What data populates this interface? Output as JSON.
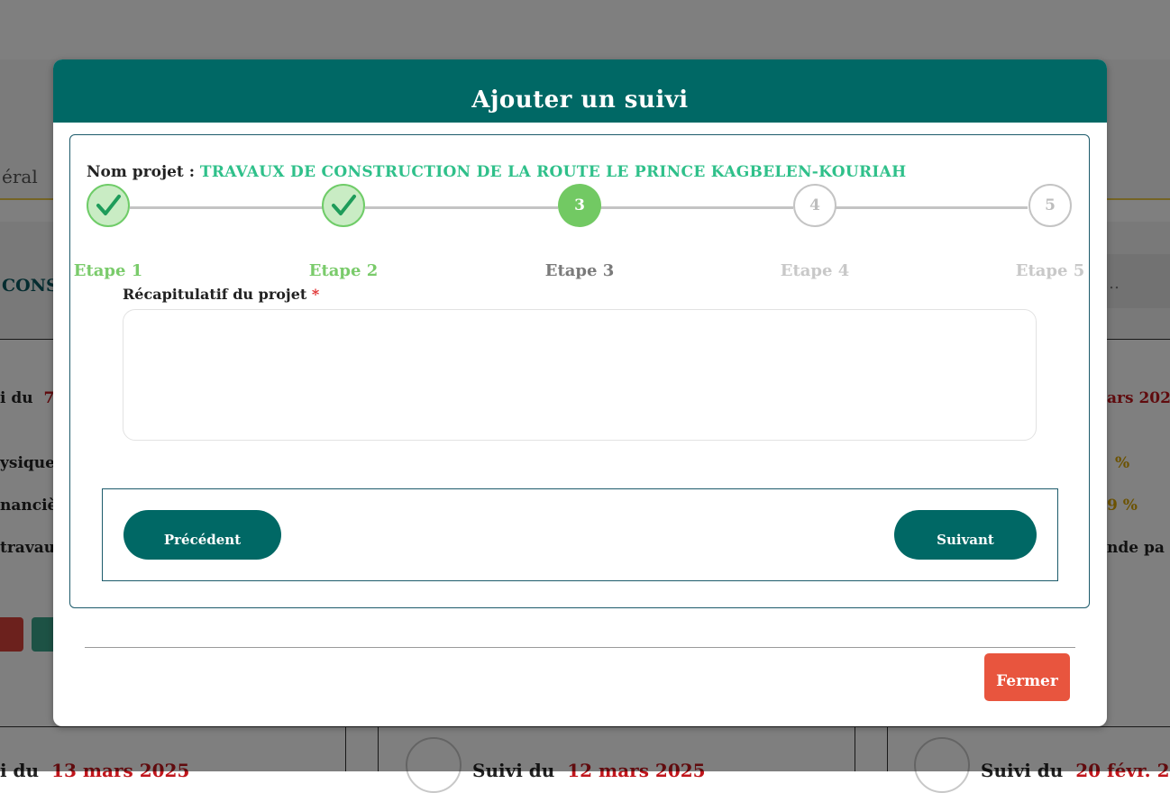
{
  "background": {
    "nav_fragment": "éral",
    "band_fragment": "CONS",
    "search_fragment": "…",
    "card_left": {
      "suivi_prefix": "i du",
      "suivi_date": "7",
      "physique": "ysique",
      "financier": "nanciè",
      "travaux": "travau"
    },
    "card_right": {
      "suivi_date": "ars 202",
      "physique_pct": "%",
      "financier_pct": "9 %",
      "commande": "nde pa ."
    },
    "lower_cards": [
      {
        "prefix": "i du",
        "date": "13 mars 2025"
      },
      {
        "prefix": "Suivi du",
        "date": "12 mars 2025"
      },
      {
        "prefix": "Suivi du",
        "date": "20 févr. 202"
      }
    ]
  },
  "modal": {
    "title": "Ajouter un suivi",
    "project_label": "Nom projet :",
    "project_name": "TRAVAUX DE CONSTRUCTION DE LA ROUTE LE PRINCE KAGBELEN-KOURIAH",
    "steps": [
      {
        "number": "1",
        "label": "Etape 1",
        "status": "done"
      },
      {
        "number": "2",
        "label": "Etape 2",
        "status": "done"
      },
      {
        "number": "3",
        "label": "Etape 3",
        "status": "active"
      },
      {
        "number": "4",
        "label": "Etape 4",
        "status": "todo"
      },
      {
        "number": "5",
        "label": "Etape 5",
        "status": "todo"
      }
    ],
    "field_label": "Récapitulatif du projet",
    "required_mark": "*",
    "field_value": "",
    "prev_button": "Précédent",
    "next_button": "Suivant",
    "close_button": "Fermer"
  },
  "colors": {
    "header": "#006865",
    "done": "#72c963",
    "close": "#e8553e",
    "project_name": "#2fc08a"
  }
}
